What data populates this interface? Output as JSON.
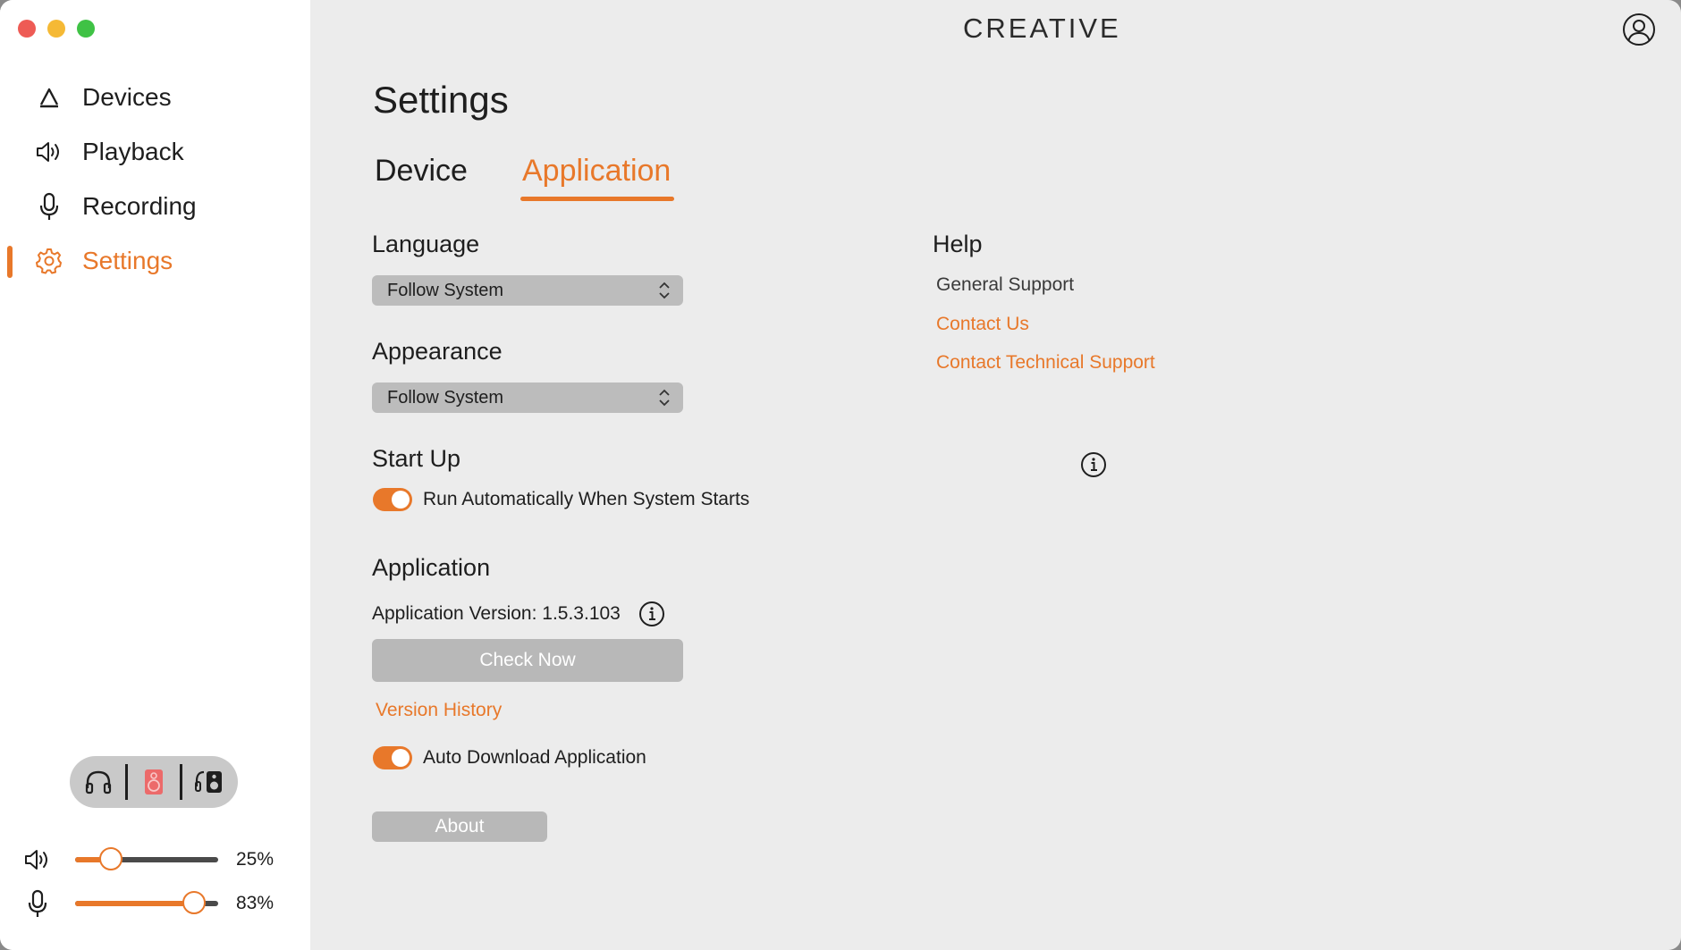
{
  "sidebar": {
    "items": [
      {
        "label": "Devices",
        "icon": "creative-logo-icon",
        "active": false
      },
      {
        "label": "Playback",
        "icon": "speaker-icon",
        "active": false
      },
      {
        "label": "Recording",
        "icon": "microphone-icon",
        "active": false
      },
      {
        "label": "Settings",
        "icon": "gear-icon",
        "active": true
      }
    ],
    "output_switch": [
      "headphones-icon",
      "speaker-box-icon",
      "headphones-speaker-icon"
    ],
    "volume": {
      "label": "25%",
      "value": 0.25
    },
    "mic": {
      "label": "83%",
      "value": 0.83
    }
  },
  "header": {
    "brand": "CREATIVE",
    "account_icon": "user-account-icon"
  },
  "main": {
    "title": "Settings",
    "tabs": [
      {
        "label": "Device",
        "active": false
      },
      {
        "label": "Application",
        "active": true
      }
    ],
    "language": {
      "title": "Language",
      "value": "Follow System"
    },
    "appearance": {
      "title": "Appearance",
      "value": "Follow System"
    },
    "startup": {
      "title": "Start Up",
      "toggle_label": "Run Automatically When System Starts",
      "enabled": true
    },
    "application": {
      "title": "Application",
      "version_text": "Application Version: 1.5.3.103",
      "check_button": "Check Now",
      "version_history": "Version History",
      "auto_download_label": "Auto Download Application",
      "auto_download_enabled": true,
      "about_button": "About"
    },
    "help": {
      "title": "Help",
      "general_support": "General Support",
      "contact_us": "Contact Us",
      "contact_tech": "Contact Technical Support"
    }
  },
  "colors": {
    "accent": "#e8782a",
    "sidebar_bg": "#ffffff",
    "main_bg": "#ececec",
    "control_gray": "#bcbcbc"
  }
}
